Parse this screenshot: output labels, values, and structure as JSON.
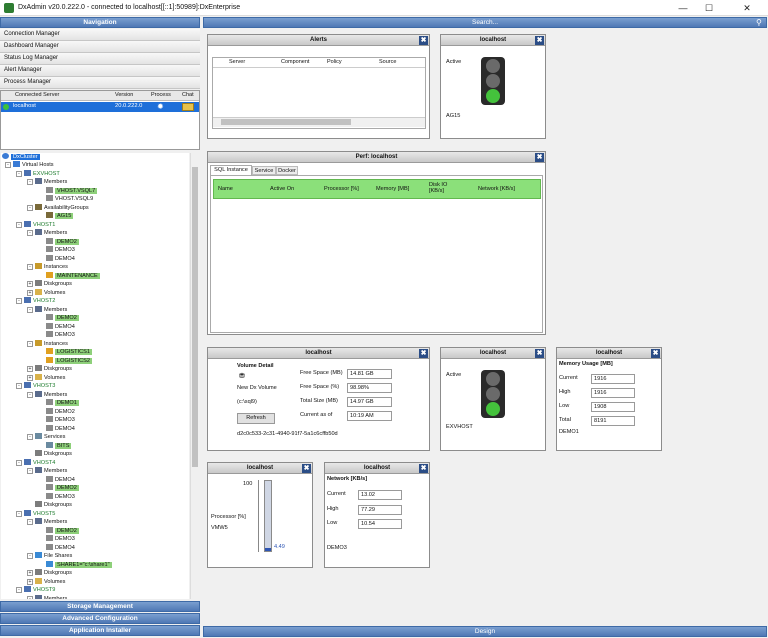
{
  "window": {
    "title": "DxAdmin v20.0.222.0 - connected to localhost[[::1]:50989]:DxEnterprise"
  },
  "navigation": {
    "header": "Navigation",
    "items": [
      "Connection Manager",
      "Dashboard Manager",
      "Status Log Manager",
      "Alert Manager",
      "Process Manager"
    ],
    "bottom": [
      "Storage Management",
      "Advanced Configuration",
      "Application Installer"
    ]
  },
  "servers": {
    "columns": [
      "Connected Server",
      "Version",
      "Process",
      "Chat"
    ],
    "rows": [
      {
        "name": "localhost",
        "version": "20.0.222.0"
      }
    ]
  },
  "tree": {
    "root": "DxCluster",
    "nodes": [
      {
        "t": "Virtual Hosts",
        "lv": 0,
        "exp": "-",
        "icon": "vh"
      },
      {
        "t": "EXVHOST",
        "lv": 1,
        "exp": "-",
        "icon": "host",
        "cls": "o"
      },
      {
        "t": "Members",
        "lv": 2,
        "exp": "-",
        "icon": "mem"
      },
      {
        "t": "VHOST.VSQL7",
        "lv": 3,
        "icon": "srv",
        "cls": "g"
      },
      {
        "t": "VHOST.VSQL9",
        "lv": 3,
        "icon": "srv"
      },
      {
        "t": "AvailabilityGroups",
        "lv": 2,
        "exp": "-",
        "icon": "ag"
      },
      {
        "t": "AG15",
        "lv": 3,
        "icon": "ag",
        "cls": "g"
      },
      {
        "t": "VHOST1",
        "lv": 1,
        "exp": "-",
        "icon": "host",
        "cls": "o"
      },
      {
        "t": "Members",
        "lv": 2,
        "exp": "-",
        "icon": "mem"
      },
      {
        "t": "DEMO2",
        "lv": 3,
        "icon": "srv",
        "cls": "g"
      },
      {
        "t": "DEMO3",
        "lv": 3,
        "icon": "srv"
      },
      {
        "t": "DEMO4",
        "lv": 3,
        "icon": "srv"
      },
      {
        "t": "Instances",
        "lv": 2,
        "exp": "-",
        "icon": "inst"
      },
      {
        "t": "MAINTENANCE",
        "lv": 3,
        "icon": "db",
        "cls": "g"
      },
      {
        "t": "Diskgroups",
        "lv": 2,
        "exp": "+",
        "icon": "disk"
      },
      {
        "t": "Volumes",
        "lv": 2,
        "exp": "+",
        "icon": "vol"
      },
      {
        "t": "VHOST2",
        "lv": 1,
        "exp": "-",
        "icon": "host",
        "cls": "o"
      },
      {
        "t": "Members",
        "lv": 2,
        "exp": "-",
        "icon": "mem"
      },
      {
        "t": "DEMO2",
        "lv": 3,
        "icon": "srv",
        "cls": "g"
      },
      {
        "t": "DEMO4",
        "lv": 3,
        "icon": "srv"
      },
      {
        "t": "DEMO3",
        "lv": 3,
        "icon": "srv"
      },
      {
        "t": "Instances",
        "lv": 2,
        "exp": "-",
        "icon": "inst"
      },
      {
        "t": "LOGISTICS1",
        "lv": 3,
        "icon": "db",
        "cls": "g"
      },
      {
        "t": "LOGISTICS2",
        "lv": 3,
        "icon": "db",
        "cls": "g"
      },
      {
        "t": "Diskgroups",
        "lv": 2,
        "exp": "+",
        "icon": "disk"
      },
      {
        "t": "Volumes",
        "lv": 2,
        "exp": "+",
        "icon": "vol"
      },
      {
        "t": "VHOST3",
        "lv": 1,
        "exp": "-",
        "icon": "host",
        "cls": "o"
      },
      {
        "t": "Members",
        "lv": 2,
        "exp": "-",
        "icon": "mem"
      },
      {
        "t": "DEMO1",
        "lv": 3,
        "icon": "srv",
        "cls": "g"
      },
      {
        "t": "DEMO2",
        "lv": 3,
        "icon": "srv"
      },
      {
        "t": "DEMO3",
        "lv": 3,
        "icon": "srv"
      },
      {
        "t": "DEMO4",
        "lv": 3,
        "icon": "srv"
      },
      {
        "t": "Services",
        "lv": 2,
        "exp": "-",
        "icon": "svc"
      },
      {
        "t": "BITS",
        "lv": 3,
        "icon": "svc",
        "cls": "g"
      },
      {
        "t": "Diskgroups",
        "lv": 2,
        "icon": "disk"
      },
      {
        "t": "VHOST4",
        "lv": 1,
        "exp": "-",
        "icon": "host",
        "cls": "o"
      },
      {
        "t": "Members",
        "lv": 2,
        "exp": "-",
        "icon": "mem"
      },
      {
        "t": "DEMO4",
        "lv": 3,
        "icon": "srv"
      },
      {
        "t": "DEMO2",
        "lv": 3,
        "icon": "srv",
        "cls": "g"
      },
      {
        "t": "DEMO3",
        "lv": 3,
        "icon": "srv"
      },
      {
        "t": "Diskgroups",
        "lv": 2,
        "icon": "disk"
      },
      {
        "t": "VHOST5",
        "lv": 1,
        "exp": "-",
        "icon": "host",
        "cls": "o"
      },
      {
        "t": "Members",
        "lv": 2,
        "exp": "-",
        "icon": "mem"
      },
      {
        "t": "DEMO2",
        "lv": 3,
        "icon": "srv",
        "cls": "g"
      },
      {
        "t": "DEMO3",
        "lv": 3,
        "icon": "srv"
      },
      {
        "t": "DEMO4",
        "lv": 3,
        "icon": "srv"
      },
      {
        "t": "File Shares",
        "lv": 2,
        "exp": "-",
        "icon": "share"
      },
      {
        "t": "SHARE1=\"c:\\share1\"",
        "lv": 3,
        "icon": "share",
        "cls": "g"
      },
      {
        "t": "Diskgroups",
        "lv": 2,
        "exp": "+",
        "icon": "disk"
      },
      {
        "t": "Volumes",
        "lv": 2,
        "exp": "+",
        "icon": "vol"
      },
      {
        "t": "VHOST9",
        "lv": 1,
        "exp": "-",
        "icon": "host",
        "cls": "o"
      },
      {
        "t": "Members",
        "lv": 2,
        "exp": "-",
        "icon": "mem"
      }
    ]
  },
  "search": {
    "label": "Search..."
  },
  "design": {
    "label": "Design"
  },
  "alerts": {
    "title": "Alerts",
    "columns": [
      "Server",
      "Component",
      "Policy",
      "Source"
    ]
  },
  "status1": {
    "title": "localhost",
    "state": "Active",
    "name": "AG15"
  },
  "perf": {
    "title": "Perf: localhost",
    "tabs": [
      "SQL Instance",
      "Service",
      "Docker"
    ],
    "columns": [
      "Name",
      "Active On",
      "Processor [%]",
      "Memory [MB]",
      "Disk IO [KB/s]",
      "Network [KB/s]"
    ]
  },
  "volume": {
    "title": "localhost",
    "heading": "Volume Detail",
    "name": "New Dx Volume",
    "path": "(c:\\sql9)",
    "refresh": "Refresh",
    "guid": "d2c0c533-2c31-4940-91f7-5a1c6cffb50d",
    "fields": [
      {
        "label": "Free Space (MB)",
        "value": "14.81 GB"
      },
      {
        "label": "Free Space (%)",
        "value": "98.98%"
      },
      {
        "label": "Total Size (MB)",
        "value": "14.97 GB"
      },
      {
        "label": "Current as of",
        "value": "10:19 AM"
      }
    ]
  },
  "status2": {
    "title": "localhost",
    "state": "Active",
    "name": "EXVHOST"
  },
  "memory": {
    "title": "localhost",
    "heading": "Memory Usage [MB]",
    "server": "DEMO1",
    "fields": [
      {
        "label": "Current",
        "value": "1916"
      },
      {
        "label": "High",
        "value": "1916"
      },
      {
        "label": "Low",
        "value": "1908"
      },
      {
        "label": "Total",
        "value": "8191"
      }
    ]
  },
  "processor": {
    "title": "localhost",
    "max": "100",
    "label": "Processor [%]",
    "server": "VMW5",
    "value": "4.49",
    "level": 0.045
  },
  "network": {
    "title": "localhost",
    "heading": "Network [KB/s]",
    "server": "DEMO3",
    "fields": [
      {
        "label": "Current",
        "value": "13.02"
      },
      {
        "label": "High",
        "value": "77.29"
      },
      {
        "label": "Low",
        "value": "10.54"
      }
    ]
  },
  "colors": {
    "accent": "#4f78b4",
    "highlight": "#8ed07a",
    "selected": "#1e6fd9",
    "green_light": "#44c23c",
    "grid_header": "#8be07a"
  }
}
